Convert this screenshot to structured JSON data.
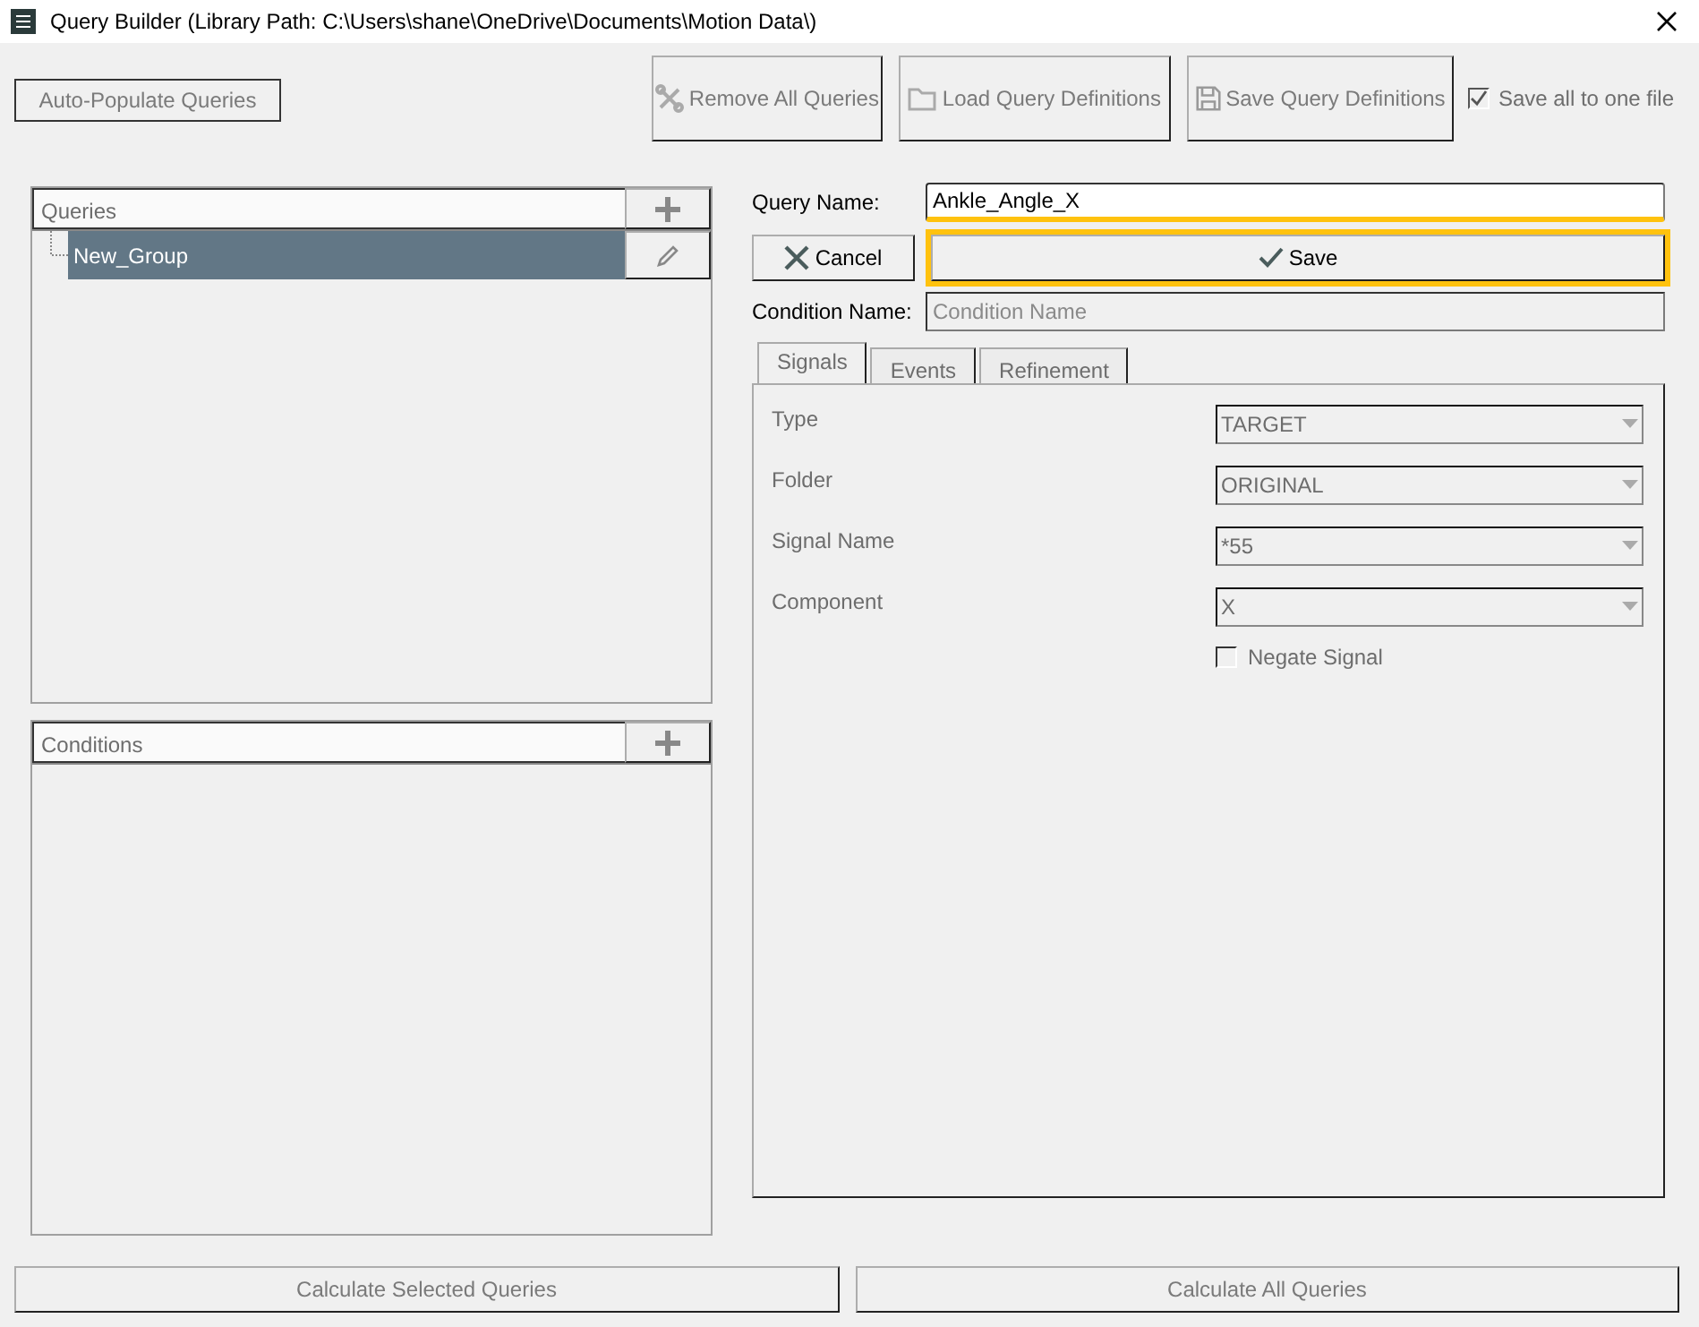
{
  "window": {
    "title": "Query Builder (Library Path: C:\\Users\\shane\\OneDrive\\Documents\\Motion Data\\)"
  },
  "toolbar": {
    "auto_populate": {
      "label": "Auto-Populate Queries",
      "disabled": true
    },
    "buttons": [
      {
        "kind": "remove",
        "label": "Remove All Queries",
        "disabled": true
      },
      {
        "kind": "load",
        "label": "Load Query Definitions",
        "disabled": true
      },
      {
        "kind": "save",
        "label": "Save Query Definitions",
        "disabled": true
      }
    ],
    "save_all": {
      "label": "Save all to one file",
      "checked": true,
      "disabled": true
    }
  },
  "queries": {
    "header": "Queries",
    "items": [
      {
        "label": "New_Group",
        "selected": true
      }
    ]
  },
  "conditions": {
    "header": "Conditions"
  },
  "query_name": {
    "label": "Query Name:",
    "value": "Ankle_Angle_X",
    "underlined": true
  },
  "cancel": {
    "label": "Cancel"
  },
  "save": {
    "label": "Save",
    "highlighted": true
  },
  "condition_name": {
    "label": "Condition Name:",
    "placeholder": "Condition Name"
  },
  "tabs": [
    {
      "label": "Signals",
      "selected": true
    },
    {
      "label": "Events",
      "selected": false
    },
    {
      "label": "Refinement",
      "selected": false
    }
  ],
  "fields": [
    {
      "label": "Type",
      "value": "TARGET"
    },
    {
      "label": "Folder",
      "value": "ORIGINAL"
    },
    {
      "label": "Signal Name",
      "value": "*55"
    },
    {
      "label": "Component",
      "value": "X"
    }
  ],
  "negate": {
    "label": "Negate Signal",
    "checked": false
  },
  "bottom_buttons": [
    {
      "label": "Calculate Selected Queries",
      "disabled": true
    },
    {
      "label": "Calculate All Queries",
      "disabled": true
    }
  ]
}
